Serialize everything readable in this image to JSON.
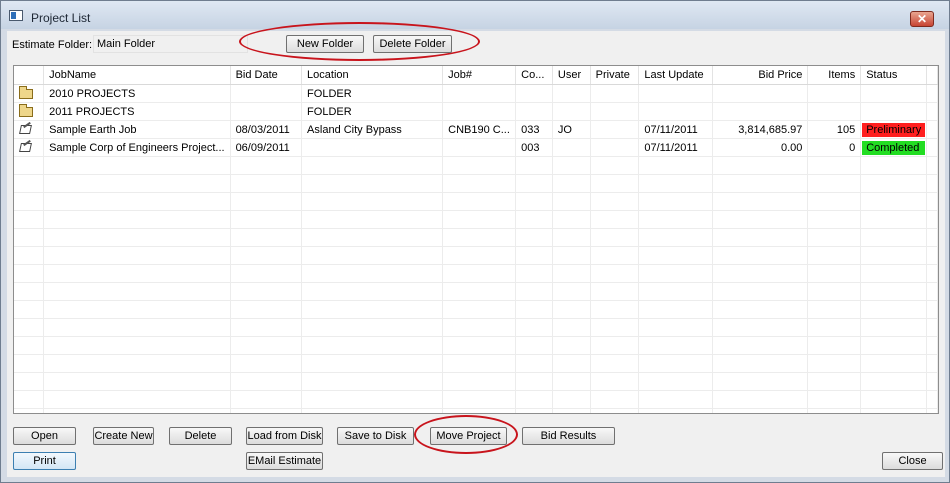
{
  "window": {
    "title": "Project List",
    "close_glyph": "✕"
  },
  "estimate_folder": {
    "label": "Estimate Folder:",
    "value": "Main Folder"
  },
  "toolbar": {
    "new_folder": "New Folder",
    "delete_folder": "Delete Folder"
  },
  "grid": {
    "columns": [
      "",
      "JobName",
      "Bid Date",
      "Location",
      "Job#",
      "Co...",
      "User",
      "Private",
      "Last Update",
      "Bid Price",
      "Items",
      "Status"
    ],
    "rows": [
      {
        "icon": "folder-icon",
        "job_name": "2010 PROJECTS",
        "bid_date": "",
        "location": "FOLDER",
        "job_no": "",
        "co": "",
        "user": "",
        "private": "",
        "last_update": "",
        "bid_price": "",
        "items": "",
        "status": "",
        "status_color": ""
      },
      {
        "icon": "folder-icon",
        "job_name": "2011 PROJECTS",
        "bid_date": "",
        "location": "FOLDER",
        "job_no": "",
        "co": "",
        "user": "",
        "private": "",
        "last_update": "",
        "bid_price": "",
        "items": "",
        "status": "",
        "status_color": ""
      },
      {
        "icon": "estimate-icon",
        "job_name": "Sample Earth Job",
        "bid_date": "08/03/2011",
        "location": "Asland City Bypass",
        "job_no": "CNB190 C...",
        "co": "033",
        "user": "JO",
        "private": "",
        "last_update": "07/11/2011",
        "bid_price": "3,814,685.97",
        "items": "105",
        "status": "Preliminary",
        "status_color": "#ff1f1f"
      },
      {
        "icon": "estimate-icon",
        "job_name": "Sample Corp of Engineers Project...",
        "bid_date": "06/09/2011",
        "location": "",
        "job_no": "",
        "co": "003",
        "user": "",
        "private": "",
        "last_update": "07/11/2011",
        "bid_price": "0.00",
        "items": "0",
        "status": "Completed",
        "status_color": "#22dd22"
      }
    ]
  },
  "buttons": {
    "open": "Open",
    "create_new": "Create New",
    "delete": "Delete",
    "load_from_disk": "Load from Disk",
    "save_to_disk": "Save to Disk",
    "move_project": "Move Project",
    "bid_results": "Bid Results",
    "print": "Print",
    "email_estimate": "EMail Estimate",
    "close": "Close"
  },
  "colors": {
    "highlight_oval": "#c8141c",
    "preliminary": "#ff1f1f",
    "completed": "#22dd22"
  }
}
